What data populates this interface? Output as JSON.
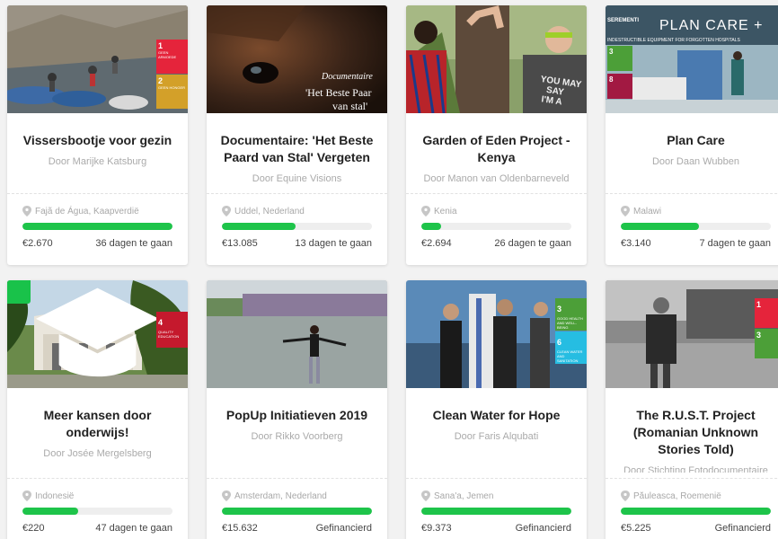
{
  "colors": {
    "progress": "#1ec44a",
    "badge": "#19c24a",
    "sdg_red": "#e5243b",
    "sdg_yellow": "#d3a029",
    "sdg_green": "#4c9f38"
  },
  "projects": [
    {
      "title": "Vissersbootje voor gezin",
      "owner": "Door Marijke Katsburg",
      "location": "Fajã de Água, Kaapverdië",
      "amount": "€2.670",
      "status": "36 dagen te gaan",
      "progress": 1.0,
      "sdg": {
        "num1": "1",
        "label1": "GEEN ARMOEDE",
        "num2": "2",
        "label2": "GEEN HONGER"
      }
    },
    {
      "title": "Documentaire: 'Het Beste Paard van Stal' Vergeten",
      "owner": "Door Equine Visions",
      "location": "Uddel, Nederland",
      "amount": "€13.085",
      "status": "13 dagen te gaan",
      "progress": 0.49,
      "overlay": {
        "line1": "Documentaire",
        "line2": "'Het Beste Paar",
        "line3": "van stal'"
      }
    },
    {
      "title": "Garden of Eden Project - Kenya",
      "owner": "Door Manon van Oldenbarneveld",
      "location": "Kenia",
      "amount": "€2.694",
      "status": "26 dagen te gaan",
      "progress": 0.13,
      "shirt": {
        "line1": "YOU MAY",
        "line2": "SAY",
        "line3": "I'M A"
      }
    },
    {
      "title": "Plan Care",
      "owner": "Door Daan Wubben",
      "location": "Malawi",
      "amount": "€3.140",
      "status": "7 dagen te gaan",
      "progress": 0.52,
      "banner": {
        "brand": "PLAN CARE +",
        "tagline": "INDESTRUCTIBLE EQUIPMENT FOR FORGOTTEN HOSPITALS",
        "logo": "SEREMENTI",
        "num1": "3",
        "num2": "8"
      }
    },
    {
      "title": "Meer kansen door onderwijs!",
      "owner": "Door Josée Mergelsberg",
      "location": "Indonesië",
      "amount": "€220",
      "status": "47 dagen te gaan",
      "progress": 0.37,
      "sdg": {
        "num1": "4",
        "label1": "QUALITY EDUCATION"
      },
      "badge_icon": "graduation-cap-icon"
    },
    {
      "title": "PopUp Initiatieven 2019",
      "owner": "Door Rikko Voorberg",
      "location": "Amsterdam, Nederland",
      "amount": "€15.632",
      "status": "Gefinancierd",
      "progress": 1.0
    },
    {
      "title": "Clean Water for Hope",
      "owner": "Door Faris Alqubati",
      "location": "Sana'a, Jemen",
      "amount": "€9.373",
      "status": "Gefinancierd",
      "progress": 1.0,
      "sdg": {
        "num1": "3",
        "label1": "GOOD HEALTH AND WELL-BEING",
        "num2": "6",
        "label2": "CLEAN WATER AND SANITATION"
      }
    },
    {
      "title": "The R.U.S.T. Project (Romanian Unknown Stories Told)",
      "owner": "Door Stichting Fotodocumentaire",
      "location": "Păuleasca, Roemenië",
      "amount": "€5.225",
      "status": "Gefinancierd",
      "progress": 1.0,
      "sdg": {
        "num1": "1",
        "num2": "3"
      }
    }
  ]
}
